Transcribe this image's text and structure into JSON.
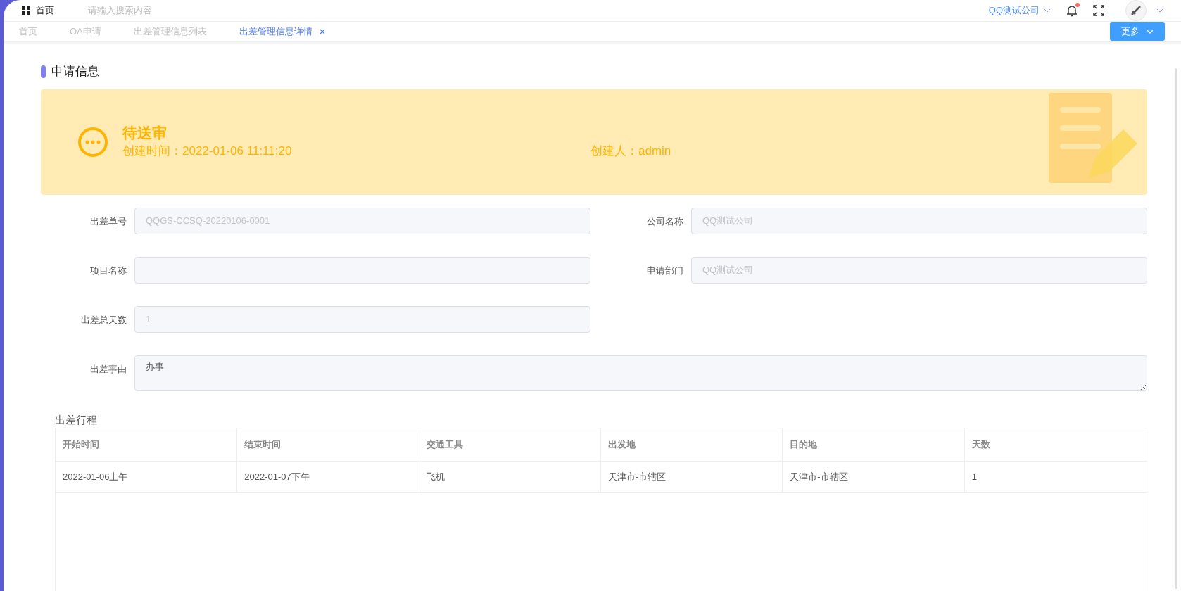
{
  "header": {
    "home": "首页",
    "search": {
      "placeholder": "请输入搜索内容"
    },
    "company": "QQ测试公司",
    "notifications": {
      "unread": true
    }
  },
  "tabs": [
    {
      "label": "首页",
      "selected": false
    },
    {
      "label": "OA申请",
      "selected": false
    },
    {
      "label": "出差管理信息列表",
      "selected": false
    },
    {
      "label": "出差管理信息详情",
      "selected": true
    }
  ],
  "more_button": "更多",
  "section_title": "申请信息",
  "status_banner": {
    "status": "待送审",
    "created_time": "创建时间：2022-01-06 11:11:20",
    "creator": "创建人：admin"
  },
  "form": {
    "fields": [
      {
        "kind": "input",
        "label": "出差单号",
        "value": "QQGS-CCSQ-20220106-0001"
      },
      {
        "kind": "input",
        "label": "公司名称",
        "value": "QQ测试公司"
      },
      {
        "kind": "input",
        "label": "项目名称"
      },
      {
        "kind": "input",
        "label": "申请部门",
        "value": "QQ测试公司"
      },
      {
        "kind": "input",
        "label": "出差总天数",
        "value": "1"
      },
      {
        "kind": "textarea",
        "label": "出差事由",
        "value": "办事"
      }
    ]
  },
  "itinerary": {
    "title": "出差行程",
    "columns": [
      "开始时间",
      "结束时间",
      "交通工具",
      "出发地",
      "目的地",
      "天数"
    ],
    "rows": [
      [
        "2022-01-06上午",
        "2022-01-07下午",
        "飞机",
        "天津市-市辖区",
        "天津市-市辖区",
        "1"
      ]
    ]
  }
}
